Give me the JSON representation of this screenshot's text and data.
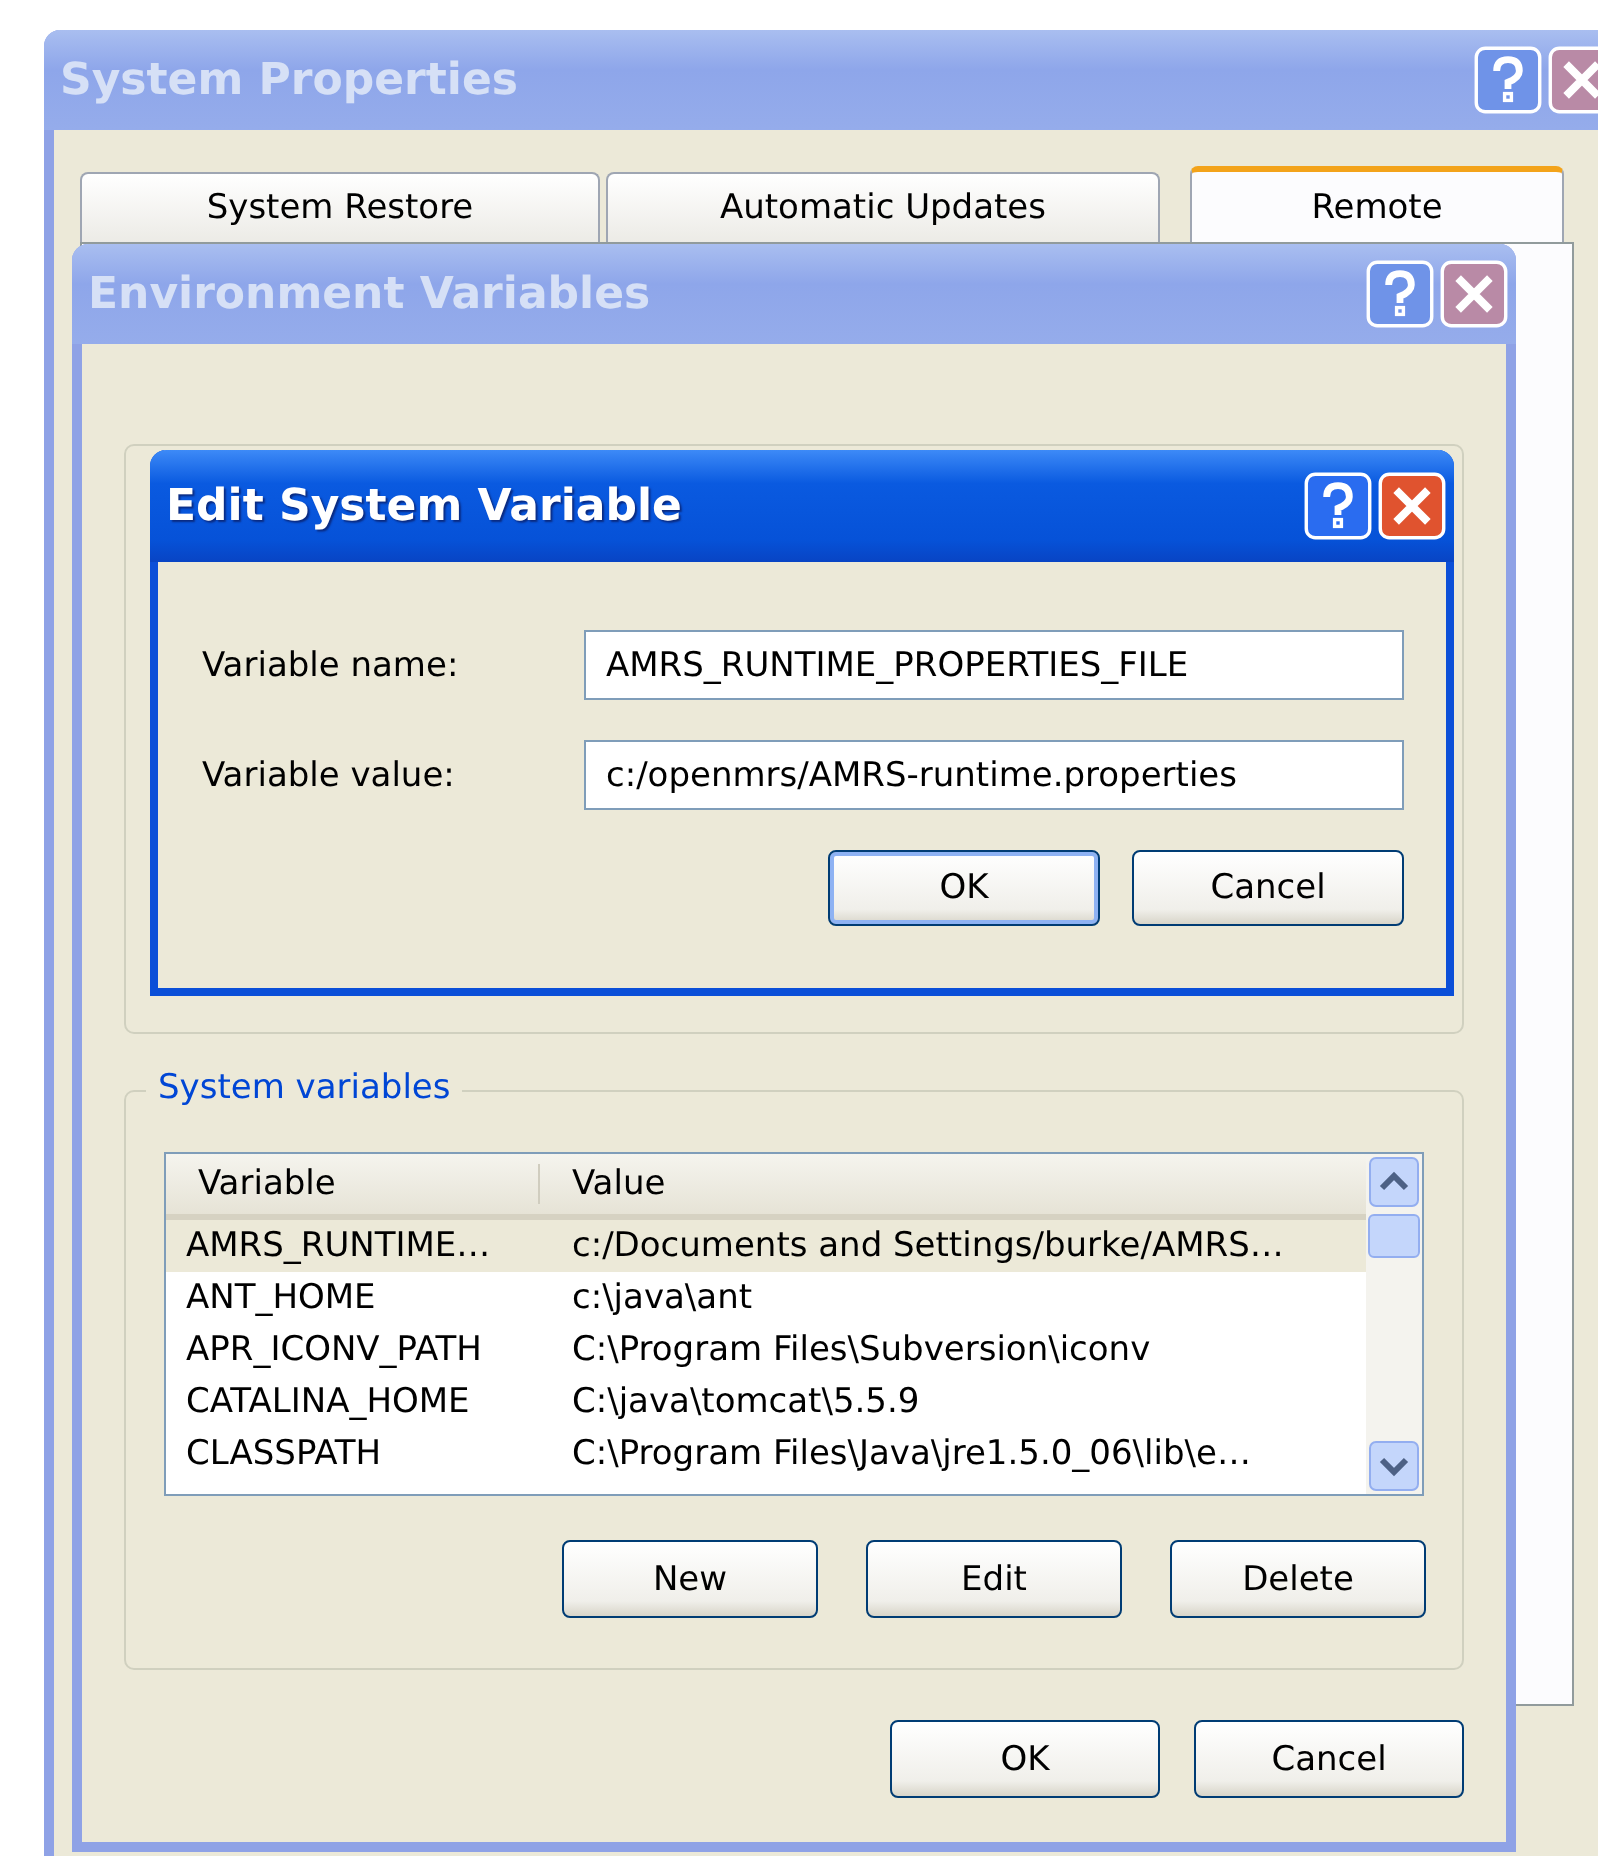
{
  "system_properties": {
    "title": "System Properties",
    "active": false,
    "tabs": [
      {
        "label": "System Restore",
        "selected": false
      },
      {
        "label": "Automatic Updates",
        "selected": false
      },
      {
        "label": "Remote",
        "selected": true
      }
    ]
  },
  "environment_variables": {
    "title": "Environment Variables",
    "active": false,
    "system_variables": {
      "label": "System variables",
      "columns": [
        "Variable",
        "Value"
      ],
      "rows": [
        {
          "variable": "AMRS_RUNTIME…",
          "value": "c:/Documents and Settings/burke/AMRS…",
          "selected": true
        },
        {
          "variable": "ANT_HOME",
          "value": "c:\\java\\ant",
          "selected": false
        },
        {
          "variable": "APR_ICONV_PATH",
          "value": "C:\\Program Files\\Subversion\\iconv",
          "selected": false
        },
        {
          "variable": "CATALINA_HOME",
          "value": "C:\\java\\tomcat\\5.5.9",
          "selected": false
        },
        {
          "variable": "CLASSPATH",
          "value": "C:\\Program Files\\Java\\jre1.5.0_06\\lib\\e…",
          "selected": false
        }
      ],
      "buttons": [
        "New",
        "Edit",
        "Delete"
      ]
    },
    "buttons": [
      "OK",
      "Cancel"
    ]
  },
  "edit_dialog": {
    "title": "Edit System Variable",
    "active": true,
    "fields": [
      {
        "label": "Variable name:",
        "value": "AMRS_RUNTIME_PROPERTIES_FILE"
      },
      {
        "label": "Variable value:",
        "value": "c:/openmrs/AMRS-runtime.properties"
      }
    ],
    "buttons": [
      "OK",
      "Cancel"
    ]
  }
}
